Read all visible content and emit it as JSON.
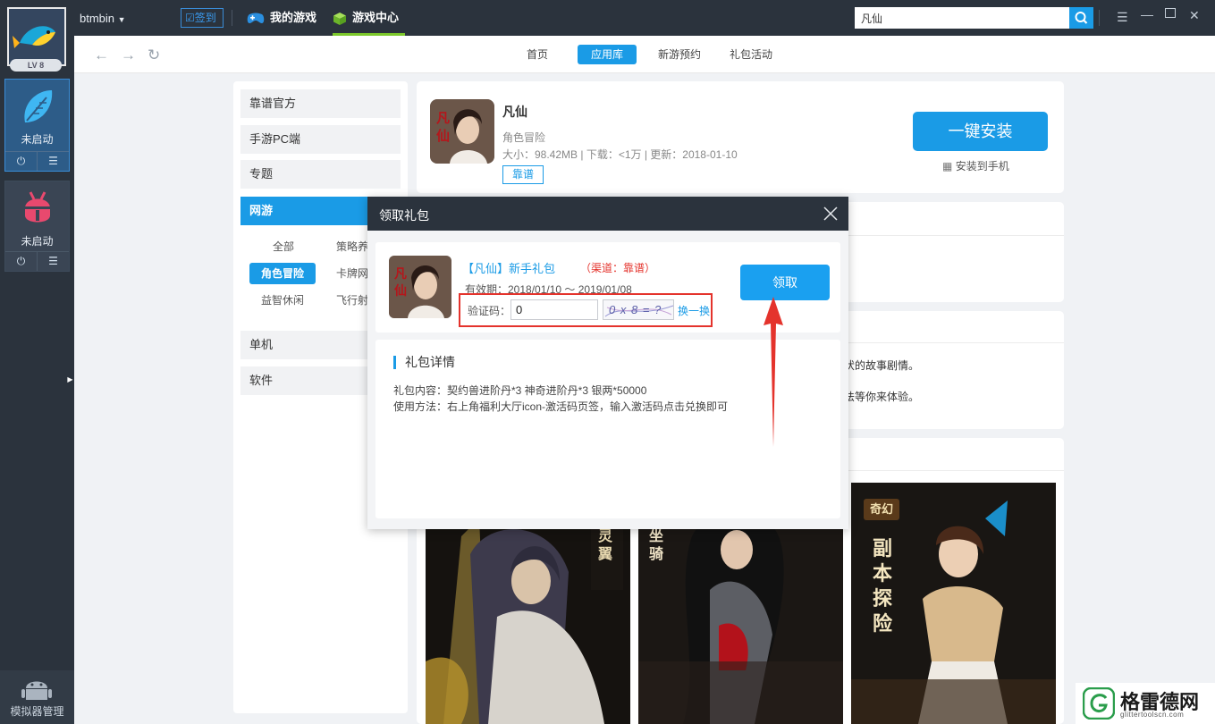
{
  "app": {
    "user": "btmbin",
    "signin_label": "签到",
    "top_tabs": [
      {
        "label": "我的游戏"
      },
      {
        "label": "游戏中心"
      }
    ],
    "search_value": "凡仙"
  },
  "sidebar": {
    "level_label": "LV 8",
    "emulators": [
      {
        "status": "未启动"
      },
      {
        "status": "未启动"
      }
    ],
    "manager_label": "模拟器管理"
  },
  "nav": {
    "tabs": [
      {
        "label": "首页"
      },
      {
        "label": "应用库"
      },
      {
        "label": "新游预约"
      },
      {
        "label": "礼包活动"
      }
    ]
  },
  "categories": {
    "main": [
      "靠谱官方",
      "手游PC端",
      "专题",
      "网游",
      "单机",
      "软件"
    ],
    "sub": [
      "全部",
      "策略养",
      "角色冒险",
      "卡牌网",
      "益智休闲",
      "飞行射"
    ]
  },
  "game": {
    "title": "凡仙",
    "genre": "角色冒险",
    "meta": "大小：98.42MB  |  下载：<1万  |  更新：2018-01-10",
    "tag": "靠谱",
    "install_label": "一键安装",
    "to_phone_label": "安装到手机",
    "desc_line1": "伏的故事剧情。",
    "desc_line2": "法等你来体验。",
    "poster_labels": [
      "特效灵翼",
      "神宠坐骑",
      "奇幻",
      "副本探险"
    ]
  },
  "modal": {
    "title": "领取礼包",
    "gift_name": "【凡仙】新手礼包",
    "channel": "（渠道：靠谱）",
    "validity": "有效期：2018/01/10 ～ 2019/01/08",
    "captcha_label": "验证码：",
    "captcha_value": "0",
    "captcha_image_text": "0 x 8 = ?",
    "swap_label": "换一换",
    "claim_label": "领取",
    "details_title": "礼包详情",
    "details_content": "礼包内容：契约兽进阶丹*3    神奇进阶丹*3    银两*50000",
    "details_usage": "使用方法：右上角福利大厅icon-激活码页签，输入激活码点击兑换即可"
  },
  "watermark": {
    "name": "格雷德网",
    "url": "glittertoolscn.com"
  },
  "colors": {
    "accent": "#1a9be6",
    "dark": "#2b333d",
    "highlight": "#e4332c",
    "active_tab_bar": "#7cc82b"
  }
}
